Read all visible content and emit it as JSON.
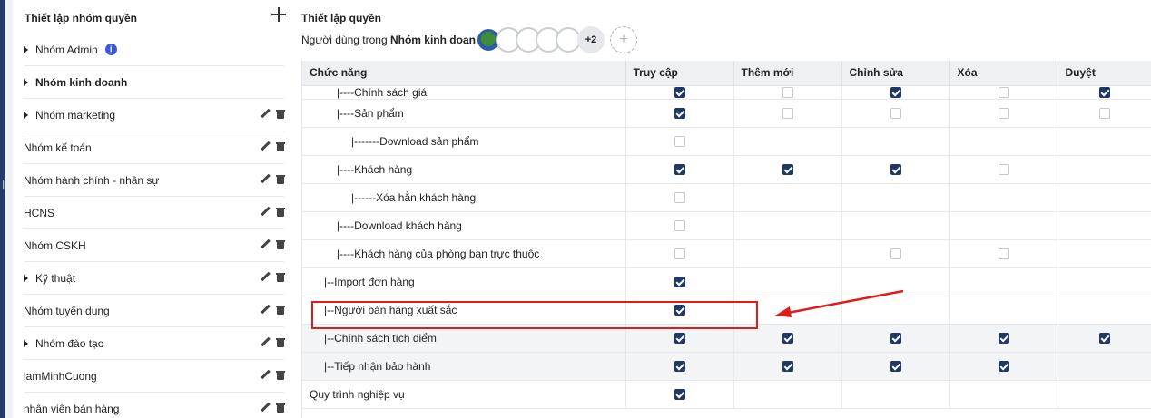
{
  "left": {
    "title": "Thiết lập nhóm quyền",
    "groups": [
      {
        "label": "Nhóm Admin",
        "caret": true,
        "bold": false,
        "info": true,
        "actions": false
      },
      {
        "label": "Nhóm kinh doanh",
        "caret": true,
        "bold": true,
        "info": false,
        "actions": false
      },
      {
        "label": "Nhóm marketing",
        "caret": true,
        "bold": false,
        "info": false,
        "actions": true
      },
      {
        "label": "Nhóm kế toán",
        "caret": false,
        "bold": false,
        "info": false,
        "actions": true
      },
      {
        "label": "Nhóm hành chính - nhân sự",
        "caret": false,
        "bold": false,
        "info": false,
        "actions": true
      },
      {
        "label": "HCNS",
        "caret": false,
        "bold": false,
        "info": false,
        "actions": true
      },
      {
        "label": "Nhóm CSKH",
        "caret": false,
        "bold": false,
        "info": false,
        "actions": true
      },
      {
        "label": "Kỹ thuật",
        "caret": true,
        "bold": false,
        "info": false,
        "actions": true
      },
      {
        "label": "Nhóm tuyển dụng",
        "caret": false,
        "bold": false,
        "info": false,
        "actions": true
      },
      {
        "label": "Nhóm đào tạo",
        "caret": true,
        "bold": false,
        "info": false,
        "actions": true
      },
      {
        "label": "lamMinhCuong",
        "caret": false,
        "bold": false,
        "info": false,
        "actions": true
      },
      {
        "label": "nhân viên bán hàng",
        "caret": false,
        "bold": false,
        "info": false,
        "actions": true
      }
    ]
  },
  "right": {
    "title": "Thiết lập quyền",
    "users_prefix": "Người dùng trong",
    "users_group": "Nhóm kinh doanh:",
    "more_count": "+2",
    "columns": [
      "Chức năng",
      "Truy cập",
      "Thêm mới",
      "Chỉnh sửa",
      "Xóa",
      "Duyệt"
    ],
    "rows": [
      {
        "label": "|----Chính sách giá",
        "cells": [
          true,
          false,
          true,
          false,
          true
        ]
      },
      {
        "label": "|----Sản phẩm",
        "cells": [
          true,
          false,
          false,
          false,
          false
        ]
      },
      {
        "label": "|-------Download sản phẩm",
        "cells": [
          false,
          null,
          null,
          null,
          null
        ]
      },
      {
        "label": "|----Khách hàng",
        "cells": [
          true,
          true,
          true,
          false,
          null
        ]
      },
      {
        "label": "|------Xóa hẳn khách hàng",
        "cells": [
          false,
          null,
          null,
          null,
          null
        ]
      },
      {
        "label": "|----Download khách hàng",
        "cells": [
          false,
          null,
          null,
          null,
          null
        ]
      },
      {
        "label": "|----Khách hàng của phòng ban trực thuộc",
        "cells": [
          false,
          null,
          false,
          false,
          null
        ]
      },
      {
        "label": "|--Import đơn hàng",
        "cells": [
          true,
          null,
          null,
          null,
          null
        ]
      },
      {
        "label": "|--Người bán hàng xuất sắc",
        "cells": [
          true,
          null,
          null,
          null,
          null
        ]
      },
      {
        "label": "|--Chính sách tích điểm",
        "cells": [
          true,
          true,
          true,
          true,
          true
        ]
      },
      {
        "label": "|--Tiếp nhận bảo hành",
        "cells": [
          true,
          true,
          true,
          true,
          null
        ]
      },
      {
        "label": "Quy trình nghiệp vụ",
        "cells": [
          true,
          null,
          null,
          null,
          null
        ]
      }
    ]
  },
  "colors": {
    "checked": "#1f3864",
    "highlight": "#e01b1b",
    "rail": "#243b6b",
    "info": "#3b5bdb"
  }
}
